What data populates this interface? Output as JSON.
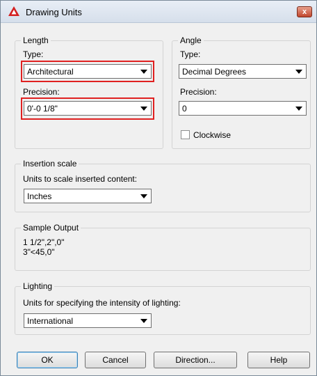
{
  "window": {
    "title": "Drawing Units",
    "close_symbol": "x"
  },
  "length": {
    "group_label": "Length",
    "type_label": "Type:",
    "type_value": "Architectural",
    "precision_label": "Precision:",
    "precision_value": "0'-0 1/8\""
  },
  "angle": {
    "group_label": "Angle",
    "type_label": "Type:",
    "type_value": "Decimal Degrees",
    "precision_label": "Precision:",
    "precision_value": "0",
    "clockwise_label": "Clockwise",
    "clockwise_checked": false
  },
  "insertion_scale": {
    "group_label": "Insertion scale",
    "units_label": "Units to scale inserted content:",
    "units_value": "Inches"
  },
  "sample_output": {
    "group_label": "Sample Output",
    "line1": "1 1/2\",2\",0\"",
    "line2": "3\"<45,0\""
  },
  "lighting": {
    "group_label": "Lighting",
    "units_label": "Units for specifying the intensity of lighting:",
    "units_value": "International"
  },
  "buttons": {
    "ok": "OK",
    "cancel": "Cancel",
    "direction": "Direction...",
    "help": "Help"
  },
  "colors": {
    "highlight": "#e02020",
    "app_icon": "#d42020",
    "close_button": "#c1462d"
  }
}
